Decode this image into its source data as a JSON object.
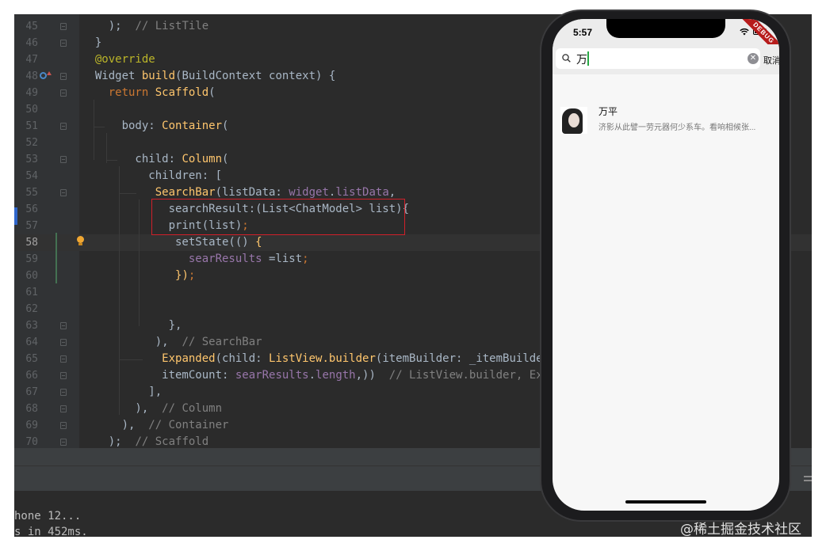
{
  "editor": {
    "lines": [
      {
        "n": "45",
        "indent": 8,
        "tokens": [
          {
            "t": "    );  ",
            "c": "plain"
          },
          {
            "t": "// ListTile",
            "c": "cmt"
          }
        ]
      },
      {
        "n": "46",
        "indent": 0,
        "tokens": [
          {
            "t": "  }",
            "c": "plain"
          }
        ]
      },
      {
        "n": "47",
        "indent": 0,
        "tokens": [
          {
            "t": "  @override",
            "c": "ann"
          }
        ]
      },
      {
        "n": "48",
        "indent": 0,
        "tokens": [
          {
            "t": "  Widget ",
            "c": "plain"
          },
          {
            "t": "build",
            "c": "fn"
          },
          {
            "t": "(BuildContext context) {",
            "c": "plain"
          }
        ]
      },
      {
        "n": "49",
        "indent": 0,
        "tokens": [
          {
            "t": "    ",
            "c": "plain"
          },
          {
            "t": "return ",
            "c": "kw"
          },
          {
            "t": "Scaffold",
            "c": "fn"
          },
          {
            "t": "(",
            "c": "plain"
          }
        ]
      },
      {
        "n": "50",
        "indent": 0,
        "tokens": [
          {
            "t": "",
            "c": "plain"
          }
        ]
      },
      {
        "n": "51",
        "indent": 0,
        "tokens": [
          {
            "t": "      body: ",
            "c": "plain"
          },
          {
            "t": "Container",
            "c": "fn"
          },
          {
            "t": "(",
            "c": "plain"
          }
        ]
      },
      {
        "n": "52",
        "indent": 0,
        "tokens": [
          {
            "t": "",
            "c": "plain"
          }
        ]
      },
      {
        "n": "53",
        "indent": 0,
        "tokens": [
          {
            "t": "        child: ",
            "c": "plain"
          },
          {
            "t": "Column",
            "c": "fn"
          },
          {
            "t": "(",
            "c": "plain"
          }
        ]
      },
      {
        "n": "54",
        "indent": 0,
        "tokens": [
          {
            "t": "          children: [",
            "c": "plain"
          }
        ]
      },
      {
        "n": "55",
        "indent": 0,
        "tokens": [
          {
            "t": "           ",
            "c": "plain"
          },
          {
            "t": "SearchBar",
            "c": "fn"
          },
          {
            "t": "(listData: ",
            "c": "plain"
          },
          {
            "t": "widget",
            "c": "field"
          },
          {
            "t": ".",
            "c": "plain"
          },
          {
            "t": "listData",
            "c": "field"
          },
          {
            "t": ",",
            "c": "plain"
          }
        ]
      },
      {
        "n": "56",
        "indent": 0,
        "tokens": [
          {
            "t": "             searchResult:(List<ChatModel> list){",
            "c": "plain"
          }
        ]
      },
      {
        "n": "57",
        "indent": 0,
        "tokens": [
          {
            "t": "             print(list)",
            "c": "plain"
          },
          {
            "t": ";",
            "c": "kw"
          }
        ]
      },
      {
        "n": "58",
        "indent": 0,
        "tokens": [
          {
            "t": "              setState(() ",
            "c": "plain"
          },
          {
            "t": "{",
            "c": "fn"
          }
        ]
      },
      {
        "n": "59",
        "indent": 0,
        "tokens": [
          {
            "t": "                ",
            "c": "plain"
          },
          {
            "t": "searResults",
            "c": "field"
          },
          {
            "t": " =list",
            "c": "plain"
          },
          {
            "t": ";",
            "c": "kw"
          }
        ]
      },
      {
        "n": "60",
        "indent": 0,
        "tokens": [
          {
            "t": "              ",
            "c": "plain"
          },
          {
            "t": "})",
            "c": "fn"
          },
          {
            "t": ";",
            "c": "kw"
          }
        ]
      },
      {
        "n": "61",
        "indent": 0,
        "tokens": [
          {
            "t": "",
            "c": "plain"
          }
        ]
      },
      {
        "n": "62",
        "indent": 0,
        "tokens": [
          {
            "t": "",
            "c": "plain"
          }
        ]
      },
      {
        "n": "63",
        "indent": 0,
        "tokens": [
          {
            "t": "             },",
            "c": "plain"
          }
        ]
      },
      {
        "n": "64",
        "indent": 0,
        "tokens": [
          {
            "t": "           ),  ",
            "c": "plain"
          },
          {
            "t": "// SearchBar",
            "c": "cmt"
          }
        ]
      },
      {
        "n": "65",
        "indent": 0,
        "tokens": [
          {
            "t": "            ",
            "c": "plain"
          },
          {
            "t": "Expanded",
            "c": "fn"
          },
          {
            "t": "(child: ",
            "c": "plain"
          },
          {
            "t": "ListView.builder",
            "c": "fn"
          },
          {
            "t": "(itemBuilder: _itemBuilder,",
            "c": "plain"
          }
        ]
      },
      {
        "n": "66",
        "indent": 0,
        "tokens": [
          {
            "t": "            itemCount: ",
            "c": "plain"
          },
          {
            "t": "searResults",
            "c": "field"
          },
          {
            "t": ".",
            "c": "plain"
          },
          {
            "t": "length",
            "c": "field"
          },
          {
            "t": ",))  ",
            "c": "plain"
          },
          {
            "t": "// ListView.builder, Expanded",
            "c": "cmt"
          }
        ]
      },
      {
        "n": "67",
        "indent": 0,
        "tokens": [
          {
            "t": "          ],",
            "c": "plain"
          }
        ]
      },
      {
        "n": "68",
        "indent": 0,
        "tokens": [
          {
            "t": "        ),  ",
            "c": "plain"
          },
          {
            "t": "// Column",
            "c": "cmt"
          }
        ]
      },
      {
        "n": "69",
        "indent": 0,
        "tokens": [
          {
            "t": "      ),  ",
            "c": "plain"
          },
          {
            "t": "// Container",
            "c": "cmt"
          }
        ]
      },
      {
        "n": "70",
        "indent": 0,
        "tokens": [
          {
            "t": "    );  ",
            "c": "plain"
          },
          {
            "t": "// Scaffold",
            "c": "cmt"
          }
        ]
      }
    ],
    "current_line": "58"
  },
  "console": {
    "line1": "hone 12...",
    "line2": "s in 452ms."
  },
  "phone": {
    "time": "5:57",
    "debug_label": "DEBUG",
    "search": {
      "query": "万",
      "clear_glyph": "✕",
      "cancel_label": "取消"
    },
    "results": [
      {
        "name": "万平",
        "message": "济影从此譬一劳元器何少系车。看响相候张..."
      }
    ]
  },
  "watermark": "@稀土掘金技术社区",
  "colors": {
    "editor_bg": "#2b2b2b",
    "keyword": "#cc7832",
    "function": "#ffc66d",
    "field": "#9876aa",
    "comment": "#808080",
    "highlight_box": "#d0202a",
    "debug_banner": "#b71c1c"
  }
}
